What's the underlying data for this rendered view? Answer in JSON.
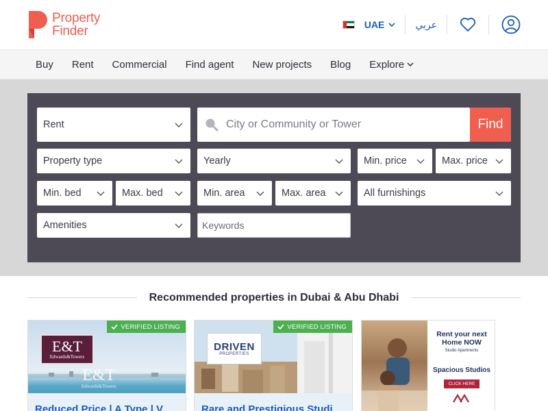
{
  "header": {
    "logo_line1": "Property",
    "logo_line2": "Finder",
    "country": "UAE",
    "language": "عربي"
  },
  "nav": {
    "items": [
      {
        "label": "Buy"
      },
      {
        "label": "Rent"
      },
      {
        "label": "Commercial"
      },
      {
        "label": "Find agent"
      },
      {
        "label": "New projects"
      },
      {
        "label": "Blog"
      },
      {
        "label": "Explore"
      }
    ]
  },
  "search": {
    "mode": "Rent",
    "location_placeholder": "City or Community or Tower",
    "find_label": "Find",
    "property_type": "Property type",
    "period": "Yearly",
    "min_price": "Min. price",
    "max_price": "Max. price",
    "min_bed": "Min. bed",
    "max_bed": "Max. bed",
    "min_area": "Min. area",
    "max_area": "Max. area",
    "furnishings": "All furnishings",
    "amenities": "Amenities",
    "keywords_placeholder": "Keywords"
  },
  "recommended": {
    "heading": "Recommended properties in Dubai & Abu Dhabi",
    "cards": [
      {
        "badge": "VERIFIED LISTING",
        "agency_big": "E&T",
        "agency_small": "Edwards&Towers",
        "watermark": "E&T",
        "watermark_sub": "Edwards&Towers",
        "title": "Reduced Price | A Type | V"
      },
      {
        "badge": "VERIFIED LISTING",
        "agency_big": "DRIVEN",
        "agency_small": "PROPERTIES",
        "title": "Rare and Prestigious Studi"
      }
    ],
    "ad": {
      "headline": "Rent your next Home NOW",
      "sub": "Studio Apartments",
      "headline2": "Spacious Studios",
      "cta": "CLICK HERE"
    }
  },
  "colors": {
    "brand": "#ef5e4e",
    "link": "#1a5cb8",
    "panel": "#4d4a55",
    "verified": "#4caf50"
  }
}
